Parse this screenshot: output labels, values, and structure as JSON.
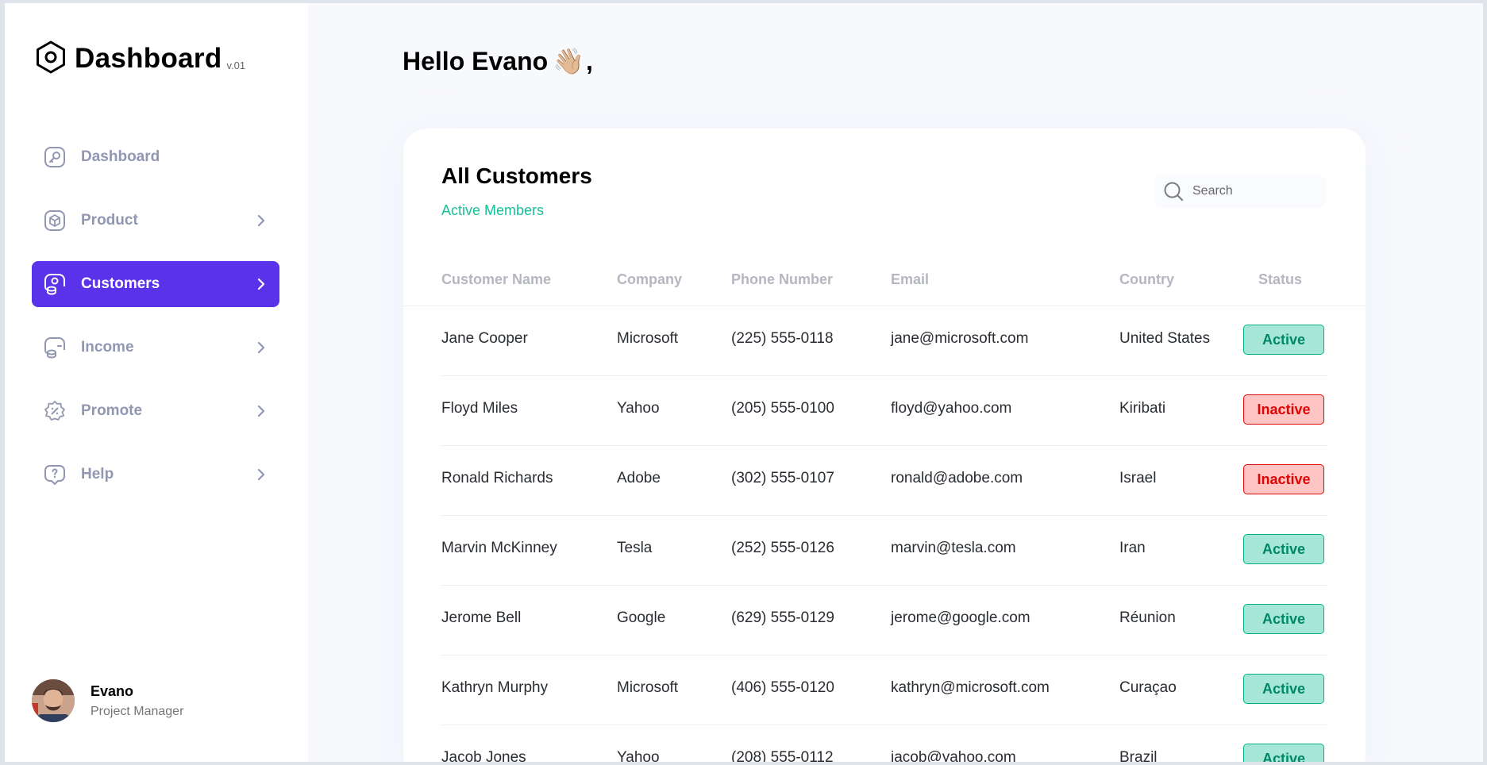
{
  "brand": {
    "title": "Dashboard",
    "version": "v.01",
    "icon": "hexagon-logo-icon"
  },
  "nav": {
    "items": [
      {
        "label": "Dashboard",
        "icon": "key-square-icon",
        "has_chevron": false,
        "active": false
      },
      {
        "label": "Product",
        "icon": "cube-icon",
        "has_chevron": true,
        "active": false
      },
      {
        "label": "Customers",
        "icon": "user-square-icon",
        "has_chevron": true,
        "active": true
      },
      {
        "label": "Income",
        "icon": "wallet-money-icon",
        "has_chevron": true,
        "active": false
      },
      {
        "label": "Promote",
        "icon": "discount-shape-icon",
        "has_chevron": true,
        "active": false
      },
      {
        "label": "Help",
        "icon": "message-question-icon",
        "has_chevron": true,
        "active": false
      }
    ]
  },
  "profile": {
    "name": "Evano",
    "role": "Project Manager"
  },
  "greeting": {
    "text": "Hello Evano",
    "emoji": "👋🏼",
    "suffix": ","
  },
  "customers": {
    "title": "All Customers",
    "subtitle": "Active Members",
    "search": {
      "placeholder": "Search"
    },
    "columns": [
      "Customer Name",
      "Company",
      "Phone Number",
      "Email",
      "Country",
      "Status"
    ],
    "rows": [
      {
        "name": "Jane Cooper",
        "company": "Microsoft",
        "phone": "(225) 555-0118",
        "email": "jane@microsoft.com",
        "country": "United States",
        "status": "Active"
      },
      {
        "name": "Floyd Miles",
        "company": "Yahoo",
        "phone": "(205) 555-0100",
        "email": "floyd@yahoo.com",
        "country": "Kiribati",
        "status": "Inactive"
      },
      {
        "name": "Ronald Richards",
        "company": "Adobe",
        "phone": "(302) 555-0107",
        "email": "ronald@adobe.com",
        "country": "Israel",
        "status": "Inactive"
      },
      {
        "name": "Marvin McKinney",
        "company": "Tesla",
        "phone": "(252) 555-0126",
        "email": "marvin@tesla.com",
        "country": "Iran",
        "status": "Active"
      },
      {
        "name": "Jerome Bell",
        "company": "Google",
        "phone": "(629) 555-0129",
        "email": "jerome@google.com",
        "country": "Réunion",
        "status": "Active"
      },
      {
        "name": "Kathryn Murphy",
        "company": "Microsoft",
        "phone": "(406) 555-0120",
        "email": "kathryn@microsoft.com",
        "country": "Curaçao",
        "status": "Active"
      },
      {
        "name": "Jacob Jones",
        "company": "Yahoo",
        "phone": "(208) 555-0112",
        "email": "jacob@yahoo.com",
        "country": "Brazil",
        "status": "Active"
      }
    ]
  },
  "colors": {
    "accent": "#5932ea",
    "nav_text": "#9197b3",
    "active_text": "#008767",
    "active_bg": "#a6e7d8",
    "inactive_text": "#df0404",
    "inactive_bg": "#ffc5c5",
    "subtitle_green": "#16c098"
  }
}
